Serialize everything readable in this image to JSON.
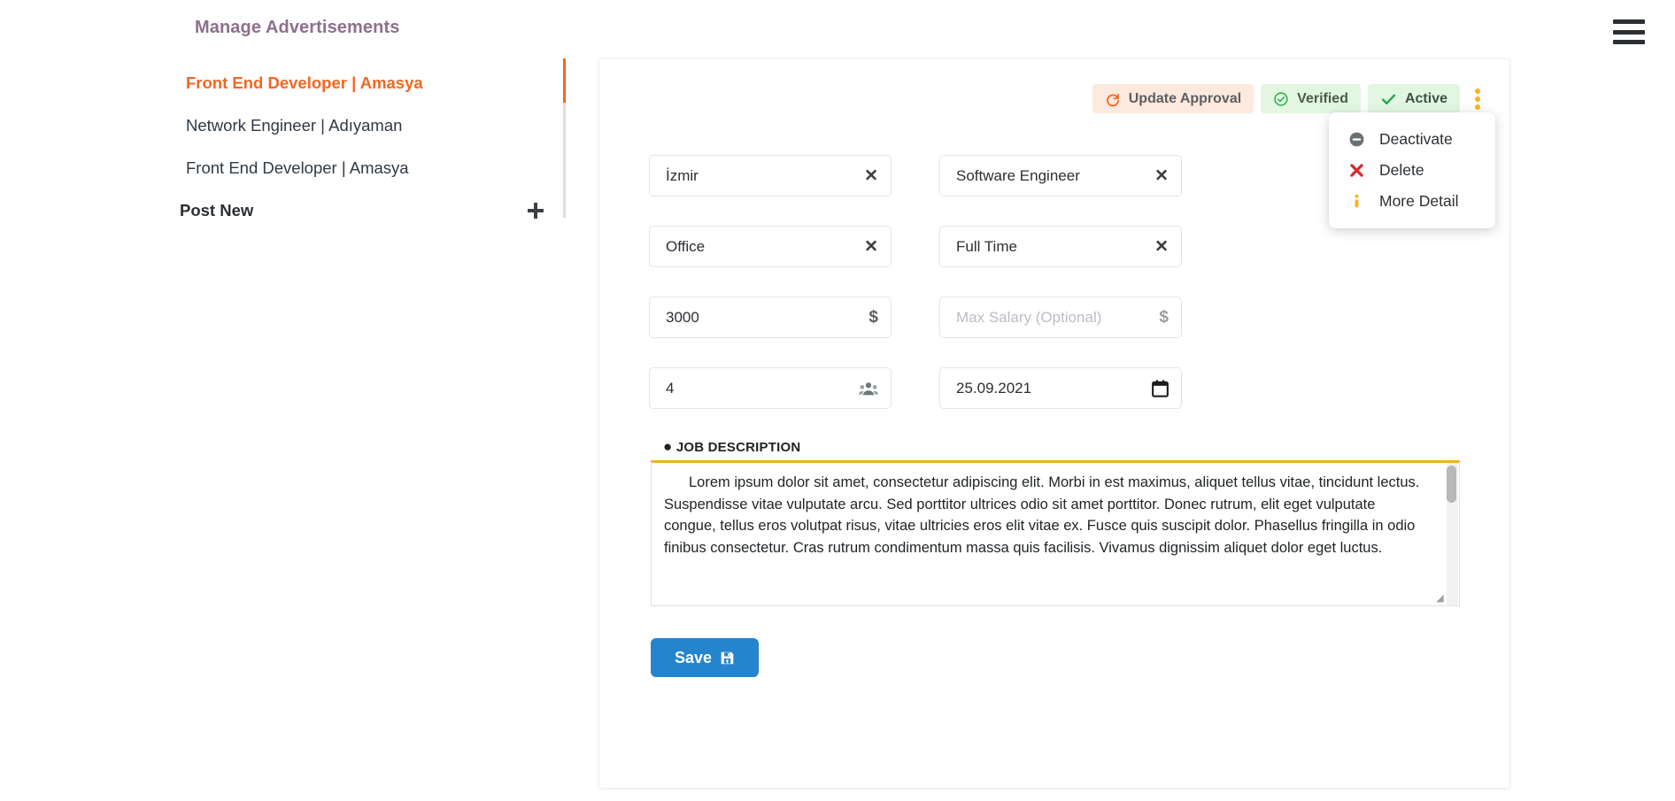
{
  "header": {
    "menu_icon": "hamburger-icon"
  },
  "sidebar": {
    "title": "Manage Advertisements",
    "items": [
      {
        "label": "Front End Developer | Amasya",
        "active": true
      },
      {
        "label": "Network Engineer | Adıyaman",
        "active": false
      },
      {
        "label": "Front End Developer | Amasya",
        "active": false
      }
    ],
    "post_new": {
      "label": "Post New",
      "icon": "plus-icon"
    },
    "accent_color": "#f26722",
    "title_color": "#8e6f8e"
  },
  "status_bar": {
    "update_approval": {
      "label": "Update Approval",
      "icon": "refresh-icon",
      "bg": "#fde9dd",
      "icon_color": "#f26722"
    },
    "verified": {
      "label": "Verified",
      "icon": "check-circle-icon",
      "bg": "#e2f6e2",
      "icon_color": "#2faa4a"
    },
    "active": {
      "label": "Active",
      "icon": "check-icon",
      "bg": "#e2f6e2",
      "icon_color": "#1ba94c"
    },
    "kebab": {
      "icon": "more-vertical-icon",
      "color": "#ffb020"
    }
  },
  "dropdown": {
    "items": [
      {
        "label": "Deactivate",
        "icon": "minus-circle-icon",
        "icon_color": "#6b7075"
      },
      {
        "label": "Delete",
        "icon": "x-mark-icon",
        "icon_color": "#d32f2f"
      },
      {
        "label": "More Detail",
        "icon": "info-icon",
        "icon_color": "#ffb020"
      }
    ]
  },
  "form": {
    "city": {
      "value": "İzmir",
      "adorn": "clear-x-icon"
    },
    "position": {
      "value": "Software Engineer",
      "adorn": "clear-x-icon"
    },
    "work_place": {
      "value": "Office",
      "adorn": "clear-x-icon"
    },
    "work_type": {
      "value": "Full Time",
      "adorn": "clear-x-icon"
    },
    "min_salary": {
      "value": "3000",
      "adorn": "dollar-icon"
    },
    "max_salary": {
      "value": "",
      "placeholder": "Max Salary (Optional)",
      "adorn": "dollar-icon"
    },
    "quota": {
      "value": "4",
      "adorn": "people-icon"
    },
    "deadline": {
      "value": "25.09.2021",
      "adorn": "calendar-icon"
    }
  },
  "job_description": {
    "label": "JOB DESCRIPTION",
    "bullet": "●",
    "text": "Lorem ipsum dolor sit amet, consectetur adipiscing elit. Morbi in est maximus, aliquet tellus vitae, tincidunt lectus. Suspendisse vitae vulputate arcu. Sed porttitor ultrices odio sit amet porttitor. Donec rutrum, elit eget vulputate congue, tellus eros volutpat risus, vitae ultricies eros elit vitae ex. Fusce quis suscipit dolor. Phasellus fringilla in odio finibus consectetur. Cras rutrum condimentum massa quis facilisis. Vivamus dignissim aliquet dolor eget luctus.",
    "accent_color": "#f0b323",
    "resize_handle": "resize-grip-icon"
  },
  "save": {
    "label": "Save",
    "icon": "floppy-disk-icon",
    "color": "#2484ce"
  }
}
